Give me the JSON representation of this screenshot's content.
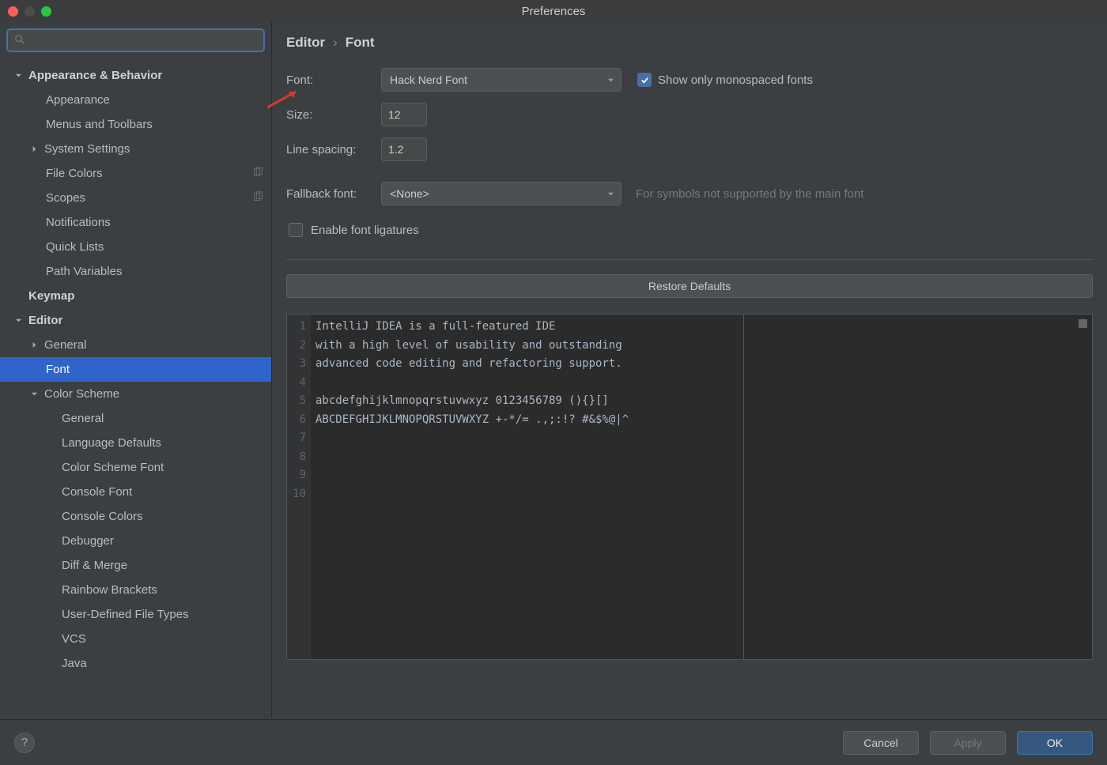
{
  "window_title": "Preferences",
  "breadcrumb": {
    "a": "Editor",
    "sep": "›",
    "b": "Font"
  },
  "sidebar": {
    "appearance_behavior": "Appearance & Behavior",
    "appearance": "Appearance",
    "menus_toolbars": "Menus and Toolbars",
    "system_settings": "System Settings",
    "file_colors": "File Colors",
    "scopes": "Scopes",
    "notifications": "Notifications",
    "quick_lists": "Quick Lists",
    "path_variables": "Path Variables",
    "keymap": "Keymap",
    "editor": "Editor",
    "general": "General",
    "font": "Font",
    "color_scheme": "Color Scheme",
    "cs_general": "General",
    "cs_lang_defaults": "Language Defaults",
    "cs_font": "Color Scheme Font",
    "cs_console_font": "Console Font",
    "cs_console_colors": "Console Colors",
    "cs_debugger": "Debugger",
    "cs_diff_merge": "Diff & Merge",
    "cs_rainbow": "Rainbow Brackets",
    "cs_udft": "User-Defined File Types",
    "cs_vcs": "VCS",
    "cs_java": "Java"
  },
  "form": {
    "font_label": "Font:",
    "font_value": "Hack Nerd Font",
    "show_mono": "Show only monospaced fonts",
    "size_label": "Size:",
    "size_value": "12",
    "linespacing_label": "Line spacing:",
    "linespacing_value": "1.2",
    "fallback_label": "Fallback font:",
    "fallback_value": "<None>",
    "fallback_hint": "For symbols not supported by the main font",
    "ligatures": "Enable font ligatures",
    "restore": "Restore Defaults"
  },
  "preview": {
    "gutter": [
      "1",
      "2",
      "3",
      "4",
      "5",
      "6",
      "7",
      "8",
      "9",
      "10"
    ],
    "lines": [
      "IntelliJ IDEA is a full-featured IDE",
      "with a high level of usability and outstanding",
      "advanced code editing and refactoring support.",
      "",
      "abcdefghijklmnopqrstuvwxyz 0123456789 (){}[]",
      "ABCDEFGHIJKLMNOPQRSTUVWXYZ +-*/= .,;:!? #&$%@|^"
    ]
  },
  "buttons": {
    "cancel": "Cancel",
    "apply": "Apply",
    "ok": "OK",
    "help": "?"
  }
}
